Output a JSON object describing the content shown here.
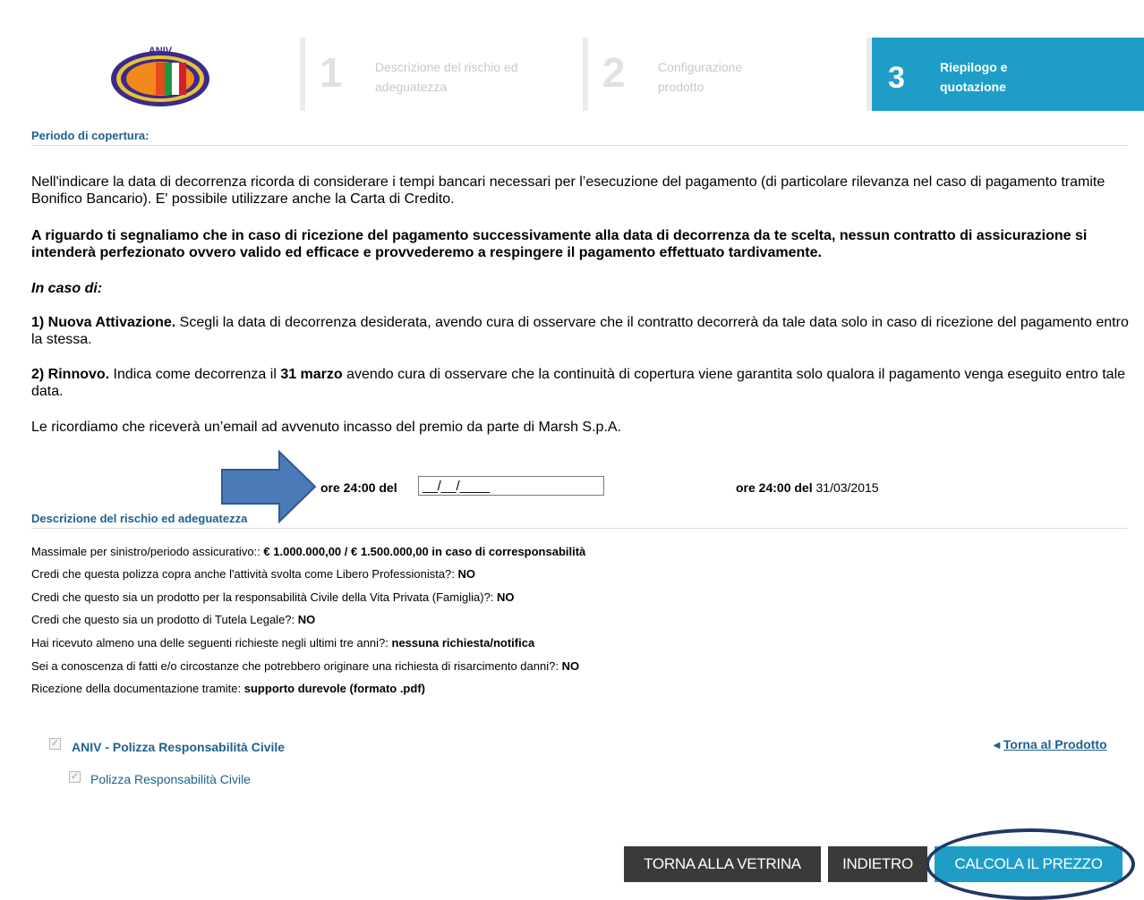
{
  "header": {
    "logo_text": "ANIV",
    "steps": [
      {
        "number": "1",
        "label": "Descrizione del rischio ed adeguatezza"
      },
      {
        "number": "2",
        "label": "Configurazione prodotto"
      },
      {
        "number": "3",
        "label": "Riepilogo e quotazione"
      }
    ]
  },
  "coverage": {
    "title": "Periodo di copertura:",
    "p1": "Nell'indicare la data di decorrenza ricorda di considerare i tempi bancari necessari per l’esecuzione del pagamento (di particolare rilevanza nel caso di pagamento tramite Bonifico Bancario). E' possibile utilizzare anche la Carta di Credito.",
    "p2": "A riguardo ti segnaliamo che in caso di ricezione del pagamento successivamente alla data di decorrenza da te scelta, nessun contratto di assicurazione si intenderà perfezionato ovvero valido ed efficace e provvederemo a respingere il pagamento effettuato tardivamente.",
    "p3": "In caso di:",
    "p4_bold": "1) Nuova Attivazione.",
    "p4_rest": " Scegli la data di decorrenza desiderata, avendo cura di osservare che il contratto decorrerà da tale data solo in caso di ricezione del pagamento entro la stessa.",
    "p5_bold": "2) Rinnovo.",
    "p5_mid1": " Indica come decorrenza il ",
    "p5_date": "31 marzo",
    "p5_mid2": " avendo cura di osservare che la continuità di copertura viene garantita solo qualora il pagamento venga eseguito entro tale data.",
    "p6": "Le ricordiamo che riceverà un’email ad avvenuto incasso del premio da parte di Marsh S.p.A.",
    "from_label": "ore 24:00 del",
    "from_value": "__/__/____",
    "to_label": "ore 24:00 del",
    "to_value": "31/03/2015"
  },
  "risk": {
    "title": "Descrizione del rischio ed adeguatezza",
    "rows": [
      {
        "q": "Massimale per sinistro/periodo assicurativo::",
        "a": "€ 1.000.000,00 / € 1.500.000,00 in caso di corresponsabilità"
      },
      {
        "q": "Credi che questa polizza copra anche l'attività svolta come Libero Professionista?:",
        "a": "NO"
      },
      {
        "q": "Credi che questo sia un prodotto per la responsabilità Civile della Vita Privata (Famiglia)?:",
        "a": "NO"
      },
      {
        "q": "Credi che questo sia un prodotto di Tutela Legale?:",
        "a": "NO"
      },
      {
        "q": "Hai ricevuto almeno una delle seguenti richieste negli ultimi tre anni?:",
        "a": "nessuna richiesta/notifica"
      },
      {
        "q": "Sei a conoscenza di fatti e/o circostanze che potrebbero originare una richiesta di risarcimento danni?:",
        "a": "NO"
      },
      {
        "q": "Ricezione della documentazione tramite:",
        "a": "supporto durevole (formato .pdf)"
      }
    ]
  },
  "products": {
    "main_label": "ANIV - Polizza Responsabilità Civile",
    "sub_label": "Polizza Responsabilità Civile",
    "back_arrow": "◂",
    "back_link": "Torna al Prodotto",
    "check_glyph": "✓"
  },
  "buttons": {
    "vetrina": "TORNA ALLA VETRINA",
    "indietro": "INDIETRO",
    "calcola": "CALCOLA IL PREZZO"
  }
}
